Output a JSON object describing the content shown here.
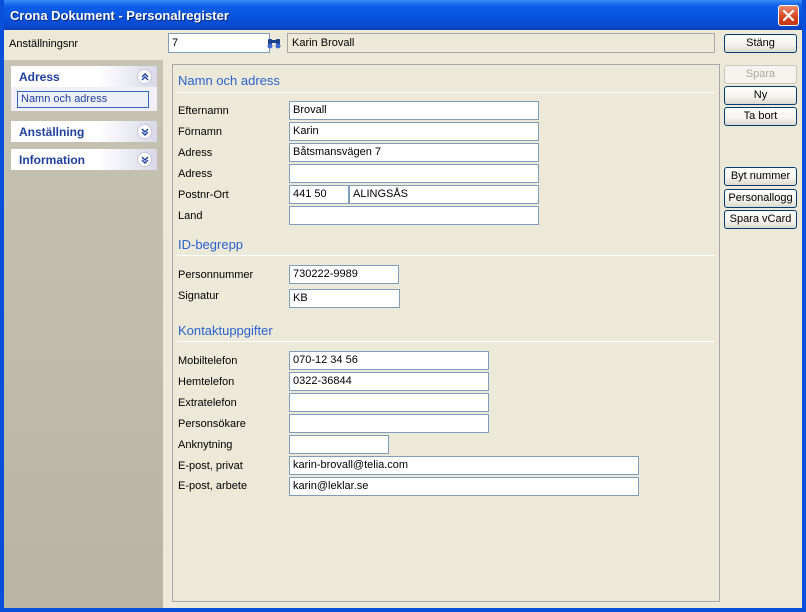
{
  "window": {
    "title": "Crona Dokument - Personalregister"
  },
  "topbar": {
    "emp_label": "Anställningsnr",
    "emp_value": "7",
    "name_display": "Karin Brovall",
    "close_label": "Stäng"
  },
  "sidebar": {
    "groups": [
      {
        "label": "Adress",
        "expanded": true,
        "items": [
          "Namn och adress"
        ]
      },
      {
        "label": "Anställning",
        "expanded": false
      },
      {
        "label": "Information",
        "expanded": false
      }
    ]
  },
  "buttons": {
    "save": "Spara",
    "new": "Ny",
    "delete": "Ta bort",
    "change_number": "Byt nummer",
    "personnel_log": "Personallogg",
    "save_vcard": "Spara vCard"
  },
  "sections": {
    "name_address": {
      "title": "Namn och adress",
      "lastname_label": "Efternamn",
      "lastname": "Brovall",
      "firstname_label": "Förnamn",
      "firstname": "Karin",
      "address1_label": "Adress",
      "address1": "Båtsmansvägen 7",
      "address2_label": "Adress",
      "address2": "",
      "postal_label": "Postnr-Ort",
      "postal_code": "441 50",
      "city": "ALINGSÅS",
      "country_label": "Land",
      "country": ""
    },
    "id": {
      "title": "ID-begrepp",
      "pnr_label": "Personnummer",
      "pnr": "730222-9989",
      "signature_label": "Signatur",
      "signature": "KB"
    },
    "contact": {
      "title": "Kontaktuppgifter",
      "mobile_label": "Mobiltelefon",
      "mobile": "070-12 34 56",
      "home_label": "Hemtelefon",
      "home": "0322-36844",
      "extra_label": "Extratelefon",
      "extra": "",
      "pager_label": "Personsökare",
      "pager": "",
      "ext_label": "Anknytning",
      "ext": "",
      "email_private_label": "E-post, privat",
      "email_private": "karin-brovall@telia.com",
      "email_work_label": "E-post, arbete",
      "email_work": "karin@leklar.se"
    }
  },
  "icons": {
    "lookup": "binoculars-icon",
    "close": "close-icon",
    "collapse": "chevron-up-icon",
    "expand": "chevron-down-icon"
  },
  "colors": {
    "titlebar": "#0a54de",
    "section_title": "#2a62cf",
    "panel_header": "#1f3f9f"
  }
}
